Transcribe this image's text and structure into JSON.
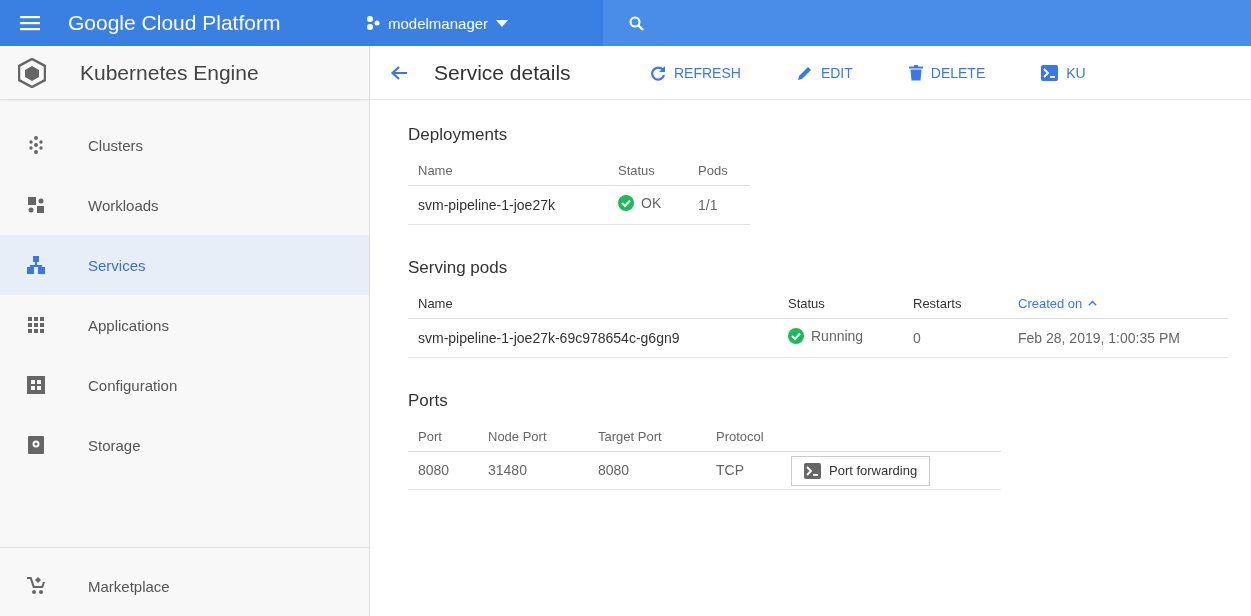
{
  "top_bar": {
    "title": "Google Cloud Platform",
    "project": "modelmanager"
  },
  "sidebar": {
    "title": "Kubernetes Engine",
    "items": [
      {
        "label": "Clusters",
        "selected": false
      },
      {
        "label": "Workloads",
        "selected": false
      },
      {
        "label": "Services",
        "selected": true
      },
      {
        "label": "Applications",
        "selected": false
      },
      {
        "label": "Configuration",
        "selected": false
      },
      {
        "label": "Storage",
        "selected": false
      }
    ],
    "footer_items": [
      {
        "label": "Marketplace",
        "selected": false
      }
    ]
  },
  "toolbar": {
    "title": "Service details",
    "actions": [
      {
        "label": "REFRESH",
        "kind": "refresh"
      },
      {
        "label": "EDIT",
        "kind": "edit"
      },
      {
        "label": "DELETE",
        "kind": "delete"
      },
      {
        "label": "KU",
        "kind": "terminal"
      }
    ]
  },
  "deployments": {
    "title": "Deployments",
    "columns": [
      "Name",
      "Status",
      "Pods"
    ],
    "rows": [
      {
        "name": "svm-pipeline-1-joe27k",
        "status": "OK",
        "pods": "1/1"
      }
    ]
  },
  "serving_pods": {
    "title": "Serving pods",
    "columns": [
      {
        "label": "Name",
        "sorted": false
      },
      {
        "label": "Status",
        "sorted": false
      },
      {
        "label": "Restarts",
        "sorted": false
      },
      {
        "label": "Created on",
        "sorted": true
      }
    ],
    "rows": [
      {
        "name": "svm-pipeline-1-joe27k-69c978654c-g6gn9",
        "status": "Running",
        "restarts": "0",
        "created_on": "Feb 28, 2019, 1:00:35 PM"
      }
    ]
  },
  "ports": {
    "title": "Ports",
    "columns": [
      "Port",
      "Node Port",
      "Target Port",
      "Protocol"
    ],
    "rows": [
      {
        "port": "8080",
        "node_port": "31480",
        "target_port": "8080",
        "protocol": "TCP",
        "action": "Port forwarding"
      }
    ]
  }
}
